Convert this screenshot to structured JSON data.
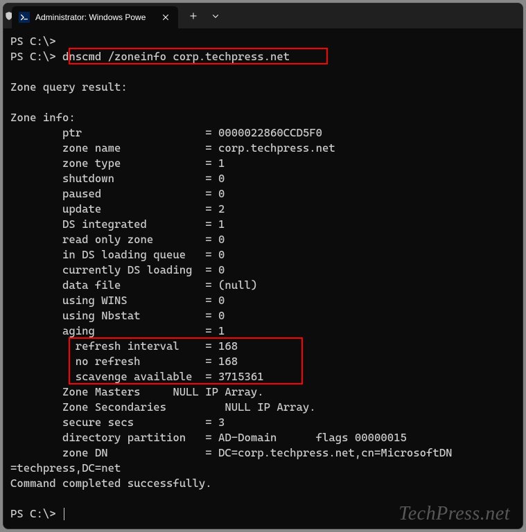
{
  "tab": {
    "title": "Administrator: Windows Powe",
    "icon_glyph": ">_"
  },
  "prompts": {
    "p1": "PS C:\\>",
    "p2": "PS C:\\> ",
    "p3": "PS C:\\> "
  },
  "command": "dnscmd /zoneinfo corp.techpress.net",
  "output": {
    "header1": "Zone query result:",
    "header2": "Zone info:",
    "lines": [
      "        ptr                   = 0000022860CCD5F0",
      "        zone name             = corp.techpress.net",
      "        zone type             = 1",
      "        shutdown              = 0",
      "        paused                = 0",
      "        update                = 2",
      "        DS integrated         = 1",
      "        read only zone        = 0",
      "        in DS loading queue   = 0",
      "        currently DS loading  = 0",
      "        data file             = (null)",
      "        using WINS            = 0",
      "        using Nbstat          = 0",
      "        aging                 = 1",
      "          refresh interval    = 168",
      "          no refresh          = 168",
      "          scavenge available  = 3715361",
      "        Zone Masters     NULL IP Array.",
      "        Zone Secondaries         NULL IP Array.",
      "        secure secs           = 3",
      "        directory partition   = AD-Domain      flags 00000015",
      "        zone DN               = DC=corp.techpress.net,cn=MicrosoftDN"
    ],
    "tail1": "=techpress,DC=net",
    "tail2": "Command completed successfully."
  },
  "watermark": "TechPress.net"
}
